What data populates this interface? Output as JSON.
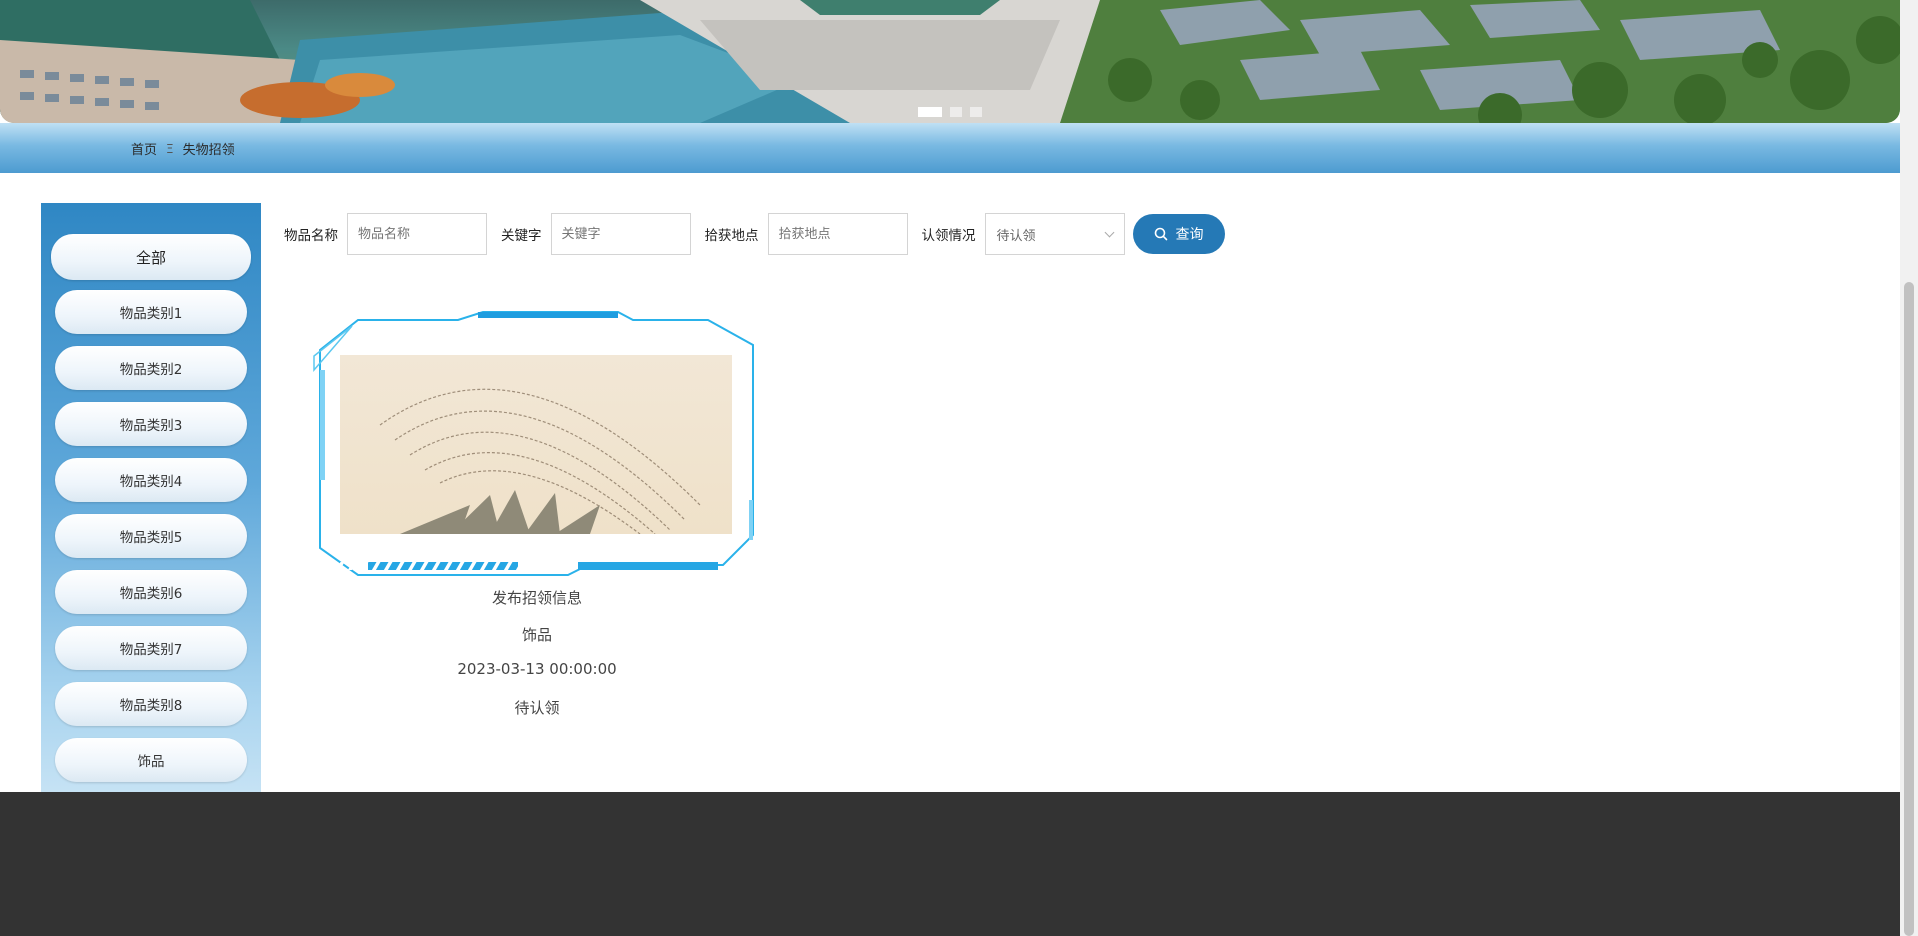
{
  "banner": {
    "slides": 3,
    "active_slide": 1
  },
  "breadcrumb": {
    "home": "首页",
    "separator": "Ξ",
    "current": "失物招领"
  },
  "sidebar": {
    "items": [
      {
        "label": "全部"
      },
      {
        "label": "物品类别1"
      },
      {
        "label": "物品类别2"
      },
      {
        "label": "物品类别3"
      },
      {
        "label": "物品类别4"
      },
      {
        "label": "物品类别5"
      },
      {
        "label": "物品类别6"
      },
      {
        "label": "物品类别7"
      },
      {
        "label": "物品类别8"
      },
      {
        "label": "饰品"
      }
    ]
  },
  "search": {
    "item_name_label": "物品名称",
    "item_name_placeholder": "物品名称",
    "keyword_label": "关键字",
    "keyword_placeholder": "关键字",
    "location_label": "拾获地点",
    "location_placeholder": "拾获地点",
    "status_label": "认领情况",
    "status_value": "待认领",
    "query_button": "查询"
  },
  "items": [
    {
      "title": "发布招领信息",
      "category": "饰品",
      "date": "2023-03-13 00:00:00",
      "status": "待认领"
    }
  ],
  "colors": {
    "primary": "#2579b6",
    "footer": "#333333"
  }
}
